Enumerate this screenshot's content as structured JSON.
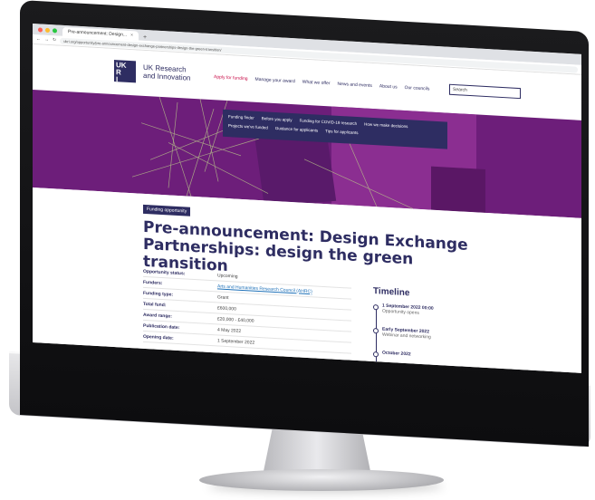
{
  "browser": {
    "tab_title": "Pre-announcement: Design...",
    "tab_close": "×",
    "new_tab": "+",
    "url": "ukri.org/opportunity/pre-announcement-design-exchange-partnerships-design-the-green-transition/",
    "nav_back": "←",
    "nav_forward": "→",
    "reload": "↻"
  },
  "header": {
    "logo_lines": [
      "UK",
      "R",
      "I"
    ],
    "brand_line1": "UK Research",
    "brand_line2": "and Innovation",
    "nav": [
      "Apply for funding",
      "Manage your award",
      "What we offer",
      "News and events",
      "About us",
      "Our councils"
    ],
    "search_placeholder": "Search"
  },
  "subnav": {
    "row1": [
      "Funding finder",
      "Before you apply",
      "Funding for COVID-19 research",
      "How we make decisions"
    ],
    "row2": [
      "Projects we've funded",
      "Guidance for applicants",
      "Tips for applicants"
    ]
  },
  "page": {
    "tag": "Funding opportunity",
    "title": "Pre-announcement: Design Exchange Partnerships: design the green transition"
  },
  "details": [
    {
      "label": "Opportunity status:",
      "value": "Upcoming",
      "link": false
    },
    {
      "label": "Funders:",
      "value": "Arts and Humanities Research Council (AHRC)",
      "link": true
    },
    {
      "label": "Funding type:",
      "value": "Grant",
      "link": false
    },
    {
      "label": "Total fund:",
      "value": "£600,000",
      "link": false
    },
    {
      "label": "Award range:",
      "value": "£20,000 - £40,000",
      "link": false
    },
    {
      "label": "Publication date:",
      "value": "4 May 2022",
      "link": false
    },
    {
      "label": "Opening date:",
      "value": "1 September 2022",
      "link": false
    }
  ],
  "timeline": {
    "title": "Timeline",
    "items": [
      {
        "date": "1 September 2022 00:00",
        "desc": "Opportunity opens"
      },
      {
        "date": "Early September 2022",
        "desc": "Webinar and networking"
      },
      {
        "date": "October 2022",
        "desc": ""
      }
    ]
  },
  "colors": {
    "navy": "#2e2d62",
    "purple": "#6d1e7a",
    "accent": "#c9114b"
  }
}
